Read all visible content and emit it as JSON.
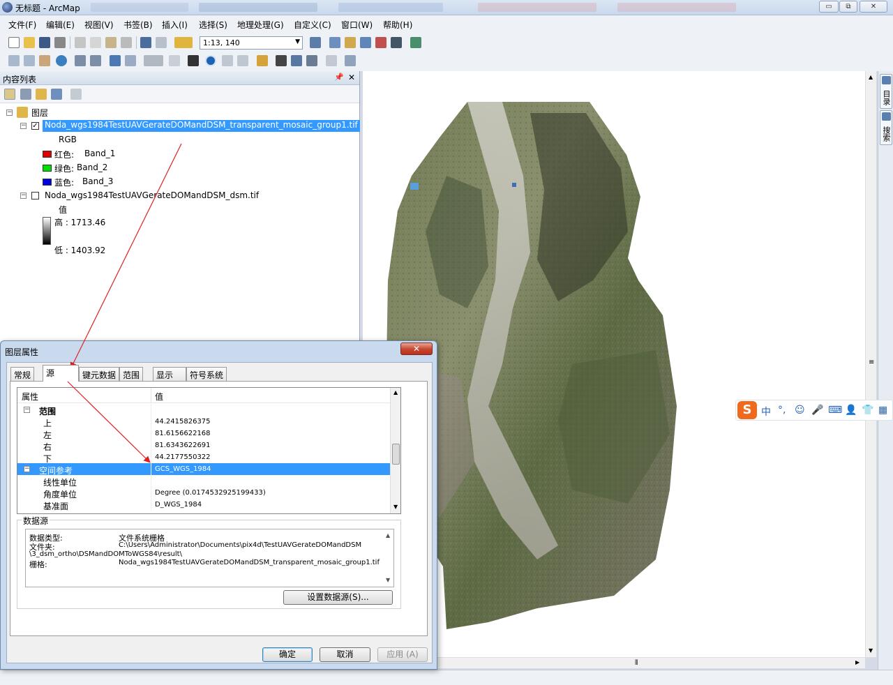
{
  "window": {
    "title": "无标题 - ArcMap",
    "buttons": [
      "▭",
      "⧉",
      "✕"
    ]
  },
  "menu": [
    "文件(F)",
    "编辑(E)",
    "视图(V)",
    "书签(B)",
    "插入(I)",
    "选择(S)",
    "地理处理(G)",
    "自定义(C)",
    "窗口(W)",
    "帮助(H)"
  ],
  "toolbar": {
    "scale": "1:13, 140"
  },
  "toc": {
    "title": "内容列表",
    "root": "图层",
    "layer1": {
      "name": "Noda_wgs1984TestUAVGerateDOMandDSM_transparent_mosaic_group1.tif",
      "type": "RGB",
      "bands": [
        {
          "label": "红色:",
          "band": "Band_1",
          "color": "#e00000"
        },
        {
          "label": "绿色:",
          "band": "Band_2",
          "color": "#00e000"
        },
        {
          "label": "蓝色:",
          "band": "Band_3",
          "color": "#0000e0"
        }
      ]
    },
    "layer2": {
      "name": "Noda_wgs1984TestUAVGerateDOMandDSM_dsm.tif",
      "value_label": "值",
      "high": "高 : 1713.46",
      "low": "低 : 1403.92"
    }
  },
  "side_tabs": [
    "目录",
    "搜索"
  ],
  "ime": {
    "logo": "S",
    "items": [
      "中",
      "°,",
      "☺",
      "🎤",
      "⌨",
      "👤",
      "👕",
      "▦"
    ]
  },
  "dialog": {
    "title": "图层属性",
    "close": "✕",
    "tabs": [
      "常规",
      "源",
      "键元数据",
      "范围",
      "显示",
      "符号系统"
    ],
    "active_tab": "源",
    "grid": {
      "col_property": "属性",
      "col_value": "值",
      "rows": [
        {
          "key": "范围",
          "value": "",
          "group": true
        },
        {
          "key": "上",
          "value": "44.2415826375"
        },
        {
          "key": "左",
          "value": "81.6156622168"
        },
        {
          "key": "右",
          "value": "81.6343622691"
        },
        {
          "key": "下",
          "value": "44.2177550322"
        },
        {
          "key": "空间参考",
          "value": "GCS_WGS_1984",
          "group": true,
          "selected": true
        },
        {
          "key": "线性单位",
          "value": ""
        },
        {
          "key": "角度单位",
          "value": "Degree (0.0174532925199433)"
        },
        {
          "key": "基准面",
          "value": "D_WGS_1984"
        }
      ]
    },
    "datasource": {
      "legend": "数据源",
      "type_label": "数据类型:",
      "type_value": "文件系统栅格",
      "folder_label": "文件夹:",
      "folder_value": "C:\\Users\\Administrator\\Documents\\pix4d\\TestUAVGerateDOMandDSM",
      "folder_value2": "\\3_dsm_ortho\\DSMandDOMToWGS84\\result\\",
      "raster_label": "栅格:",
      "raster_value": "Noda_wgs1984TestUAVGerateDOMandDSM_transparent_mosaic_group1.tif",
      "set_button": "设置数据源(S)..."
    },
    "buttons": {
      "ok": "确定",
      "cancel": "取消",
      "apply": "应用 (A)"
    }
  },
  "colors": {
    "selection": "#3399ff",
    "annotation_arrow": "#e02020",
    "ime_accent": "#f06a1d"
  }
}
